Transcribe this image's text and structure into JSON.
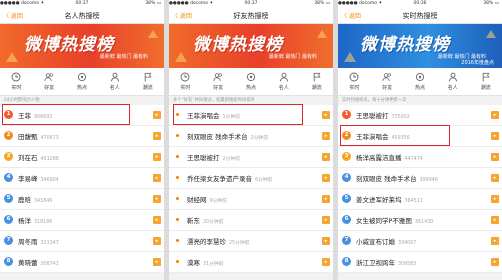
{
  "status": {
    "carrier": "●●●●● docomo ✦",
    "battery": "38% ▭"
  },
  "banner": {
    "title": "微博热搜榜",
    "subtitle": "最新鲜 最热门 最有料",
    "year_text": "2016年度盘点"
  },
  "colors": {
    "accent": "#f08a00",
    "rank1": "#f25c2a",
    "rank2": "#f58a23",
    "rank3": "#f5a623",
    "rank_other": "#4a90e2",
    "highlight": "#e2242f"
  },
  "phones": [
    {
      "time": "00:37",
      "back": "〈 返回",
      "title": "名人热搜榜",
      "hint": "24小时影响力人物",
      "rows": [
        {
          "rank": "1",
          "name": "王菲",
          "value": "906692"
        },
        {
          "rank": "2",
          "name": "田馥甄",
          "value": "470673"
        },
        {
          "rank": "3",
          "name": "刘在石",
          "value": "451288"
        },
        {
          "rank": "4",
          "name": "李易峰",
          "value": "346904"
        },
        {
          "rank": "5",
          "name": "鹿晗",
          "value": "341846"
        },
        {
          "rank": "6",
          "name": "杨洋",
          "value": "318186"
        },
        {
          "rank": "7",
          "name": "周冬雨",
          "value": "311347"
        },
        {
          "rank": "8",
          "name": "黄晓蕾",
          "value": "308741"
        }
      ]
    },
    {
      "time": "00:37",
      "back": "〈 返回",
      "title": "好友热搜榜",
      "hint": "多个“好友”共同搜过，按最新搜索时间排序",
      "rows": [
        {
          "name": "王菲演唱会",
          "value": "1分钟前"
        },
        {
          "name": "刻双眼皮 残命手术台",
          "value": "2分钟前"
        },
        {
          "name": "王思聪被打",
          "value": "2分钟前"
        },
        {
          "name": "乔任梁女友争遗产录音",
          "value": "6分钟前"
        },
        {
          "name": "财经网",
          "value": "9分钟前"
        },
        {
          "name": "靳东",
          "value": "20分钟前"
        },
        {
          "name": "漂亮的李慧珍",
          "value": "25分钟前"
        },
        {
          "name": "漠寒",
          "value": "31分钟前"
        }
      ]
    },
    {
      "time": "00:36",
      "back": "〈 返回",
      "title": "实时热搜榜",
      "hint": "实时热搜排名，每十分钟更新一次",
      "rows": [
        {
          "rank": "1",
          "name": "王思聪被打",
          "value": "735002"
        },
        {
          "rank": "2",
          "name": "王菲演唱会",
          "value": "459356"
        },
        {
          "rank": "3",
          "name": "杨洋高露洁直播",
          "value": "447474"
        },
        {
          "rank": "4",
          "name": "刻双眼皮 残命手术台",
          "value": "399946"
        },
        {
          "rank": "5",
          "name": "姜文进军好莱坞",
          "value": "364511"
        },
        {
          "rank": "6",
          "name": "女生被同学P不雅图",
          "value": "361430"
        },
        {
          "rank": "7",
          "name": "小威宣布订婚",
          "value": "334007"
        },
        {
          "rank": "8",
          "name": "浙江卫视跨年",
          "value": "309583"
        }
      ]
    }
  ],
  "tabs": [
    {
      "label": "实时",
      "icon": "clock-icon"
    },
    {
      "label": "好友",
      "icon": "friends-icon"
    },
    {
      "label": "热点",
      "icon": "hot-icon"
    },
    {
      "label": "名人",
      "icon": "person-icon"
    },
    {
      "label": "潮流",
      "icon": "flag-icon"
    }
  ]
}
